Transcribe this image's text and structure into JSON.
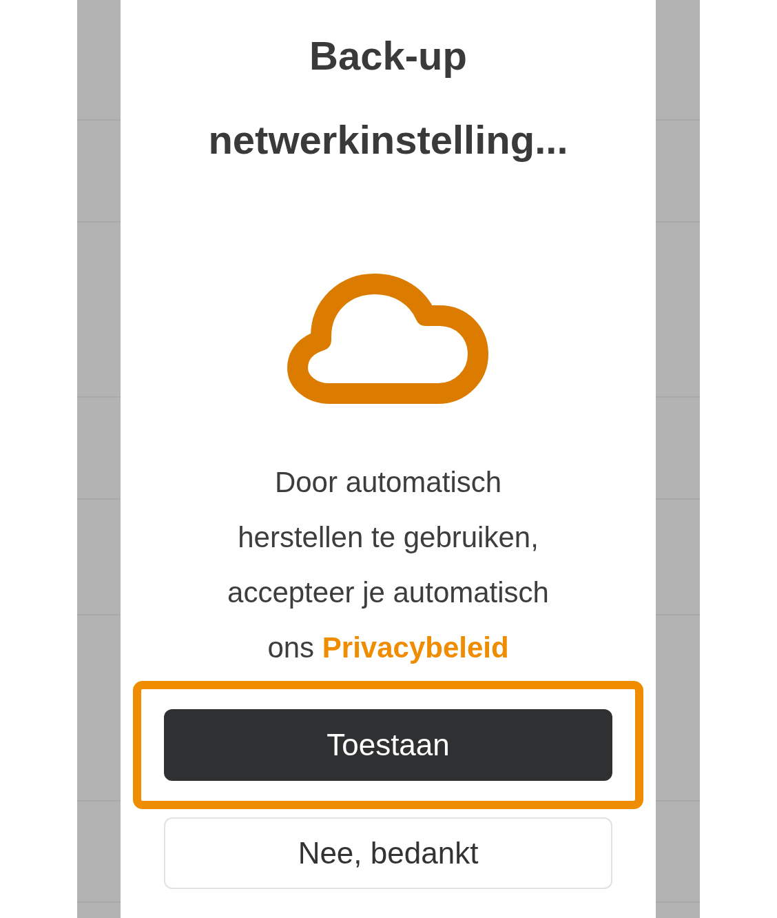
{
  "dialog": {
    "title": "Back-up netwerkinstelling...",
    "message_lines": [
      "Door automatisch",
      "herstellen te gebruiken,",
      "accepteer je automatisch",
      "ons"
    ],
    "link": "Privacybeleid",
    "buttons": [
      {
        "label": "Toestaan",
        "kind": "primary",
        "highlighted": true
      },
      {
        "label": "Nee, bedankt",
        "kind": "secondary",
        "highlighted": false
      }
    ]
  }
}
